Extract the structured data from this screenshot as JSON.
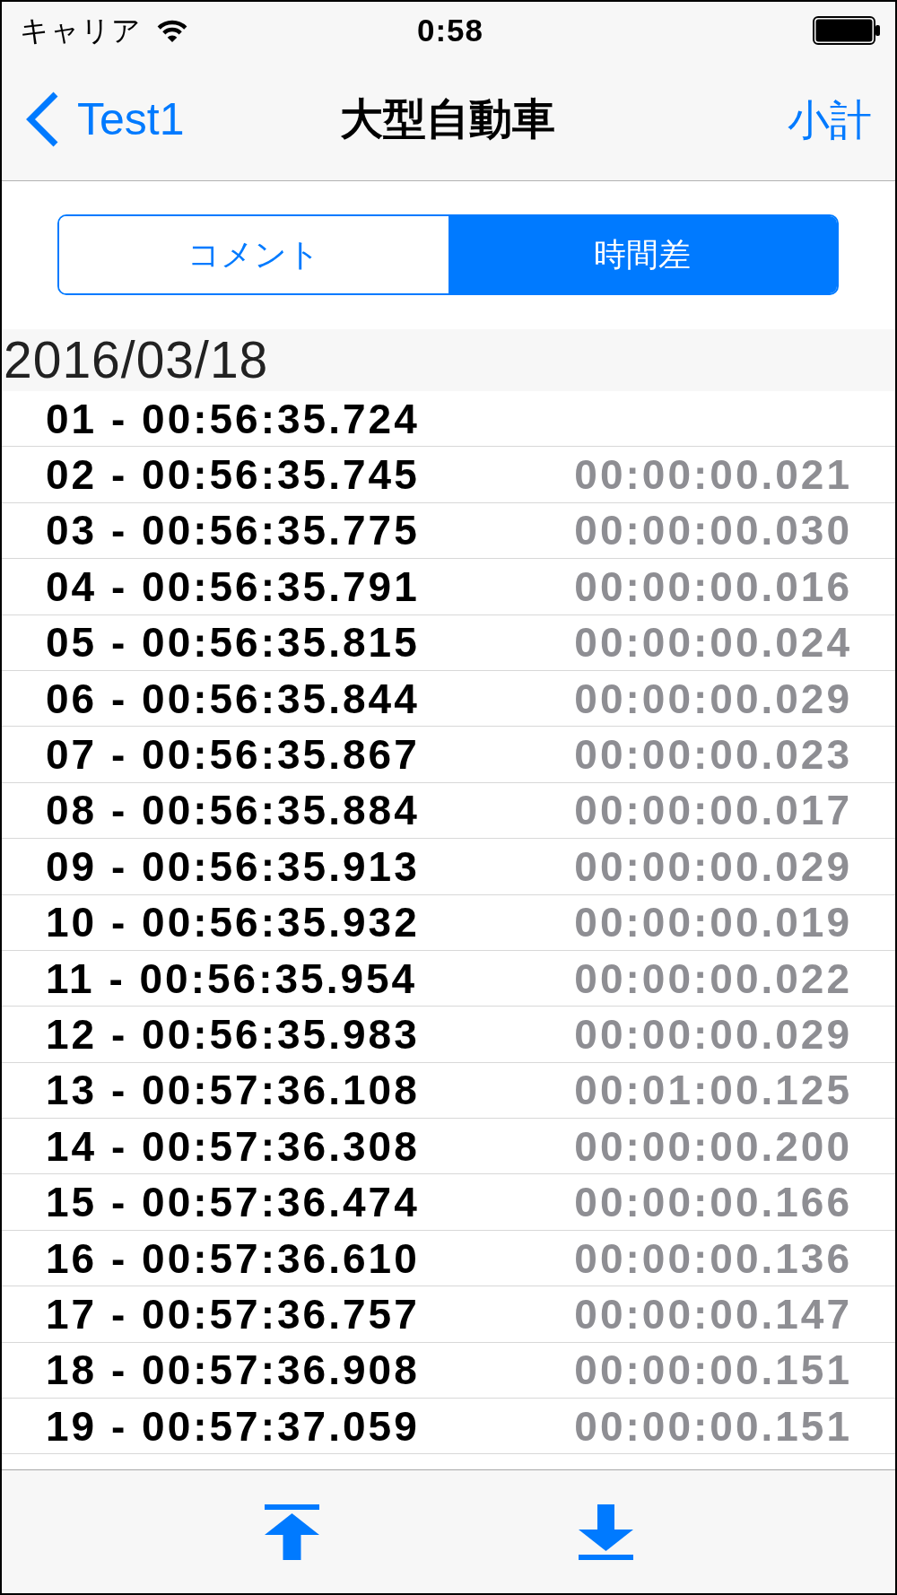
{
  "status_bar": {
    "carrier": "キャリア",
    "time": "0:58"
  },
  "nav_bar": {
    "back_label": "Test1",
    "title": "大型自動車",
    "right_button": "小計"
  },
  "segments": [
    {
      "label": "コメント",
      "selected": false
    },
    {
      "label": "時間差",
      "selected": true
    }
  ],
  "sections": [
    {
      "header": "2016/03/18",
      "rows": [
        {
          "time": "01 - 00:56:35.724"
        },
        {
          "time": "02 - 00:56:35.745",
          "difference": "00:00:00.021"
        },
        {
          "time": "03 - 00:56:35.775",
          "difference": "00:00:00.030"
        },
        {
          "time": "04 - 00:56:35.791",
          "difference": "00:00:00.016"
        },
        {
          "time": "05 - 00:56:35.815",
          "difference": "00:00:00.024"
        },
        {
          "time": "06 - 00:56:35.844",
          "difference": "00:00:00.029"
        },
        {
          "time": "07 - 00:56:35.867",
          "difference": "00:00:00.023"
        },
        {
          "time": "08 - 00:56:35.884",
          "difference": "00:00:00.017"
        },
        {
          "time": "09 - 00:56:35.913",
          "difference": "00:00:00.029"
        },
        {
          "time": "10 - 00:56:35.932",
          "difference": "00:00:00.019"
        },
        {
          "time": "11 - 00:56:35.954",
          "difference": "00:00:00.022"
        },
        {
          "time": "12 - 00:56:35.983",
          "difference": "00:00:00.029"
        },
        {
          "time": "13 - 00:57:36.108",
          "difference": "00:01:00.125"
        },
        {
          "time": "14 - 00:57:36.308",
          "difference": "00:00:00.200"
        },
        {
          "time": "15 - 00:57:36.474",
          "difference": "00:00:00.166"
        },
        {
          "time": "16 - 00:57:36.610",
          "difference": "00:00:00.136"
        },
        {
          "time": "17 - 00:57:36.757",
          "difference": "00:00:00.147"
        },
        {
          "time": "18 - 00:57:36.908",
          "difference": "00:00:00.151"
        },
        {
          "time": "19 - 00:57:37.059",
          "difference": "00:00:00.151"
        }
      ]
    }
  ]
}
